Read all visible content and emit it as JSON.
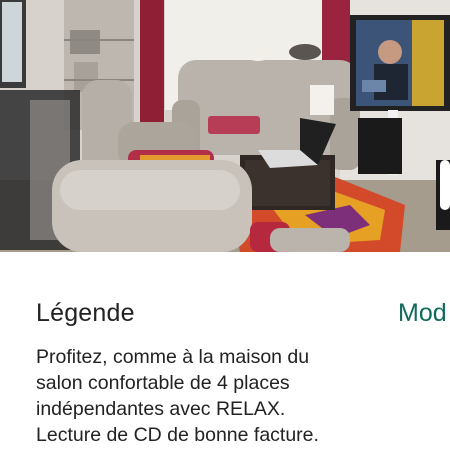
{
  "photo": {
    "alt_icon": "living-room-photo"
  },
  "caption": {
    "title": "Légende",
    "modify_label": "Mod",
    "lines": [
      "Profitez, comme à la maison du",
      "salon confortable de 4 places",
      "indépendantes avec RELAX.",
      "Lecture de CD de bonne facture."
    ]
  },
  "colors": {
    "link": "#0f6b5b",
    "text": "#222222"
  }
}
